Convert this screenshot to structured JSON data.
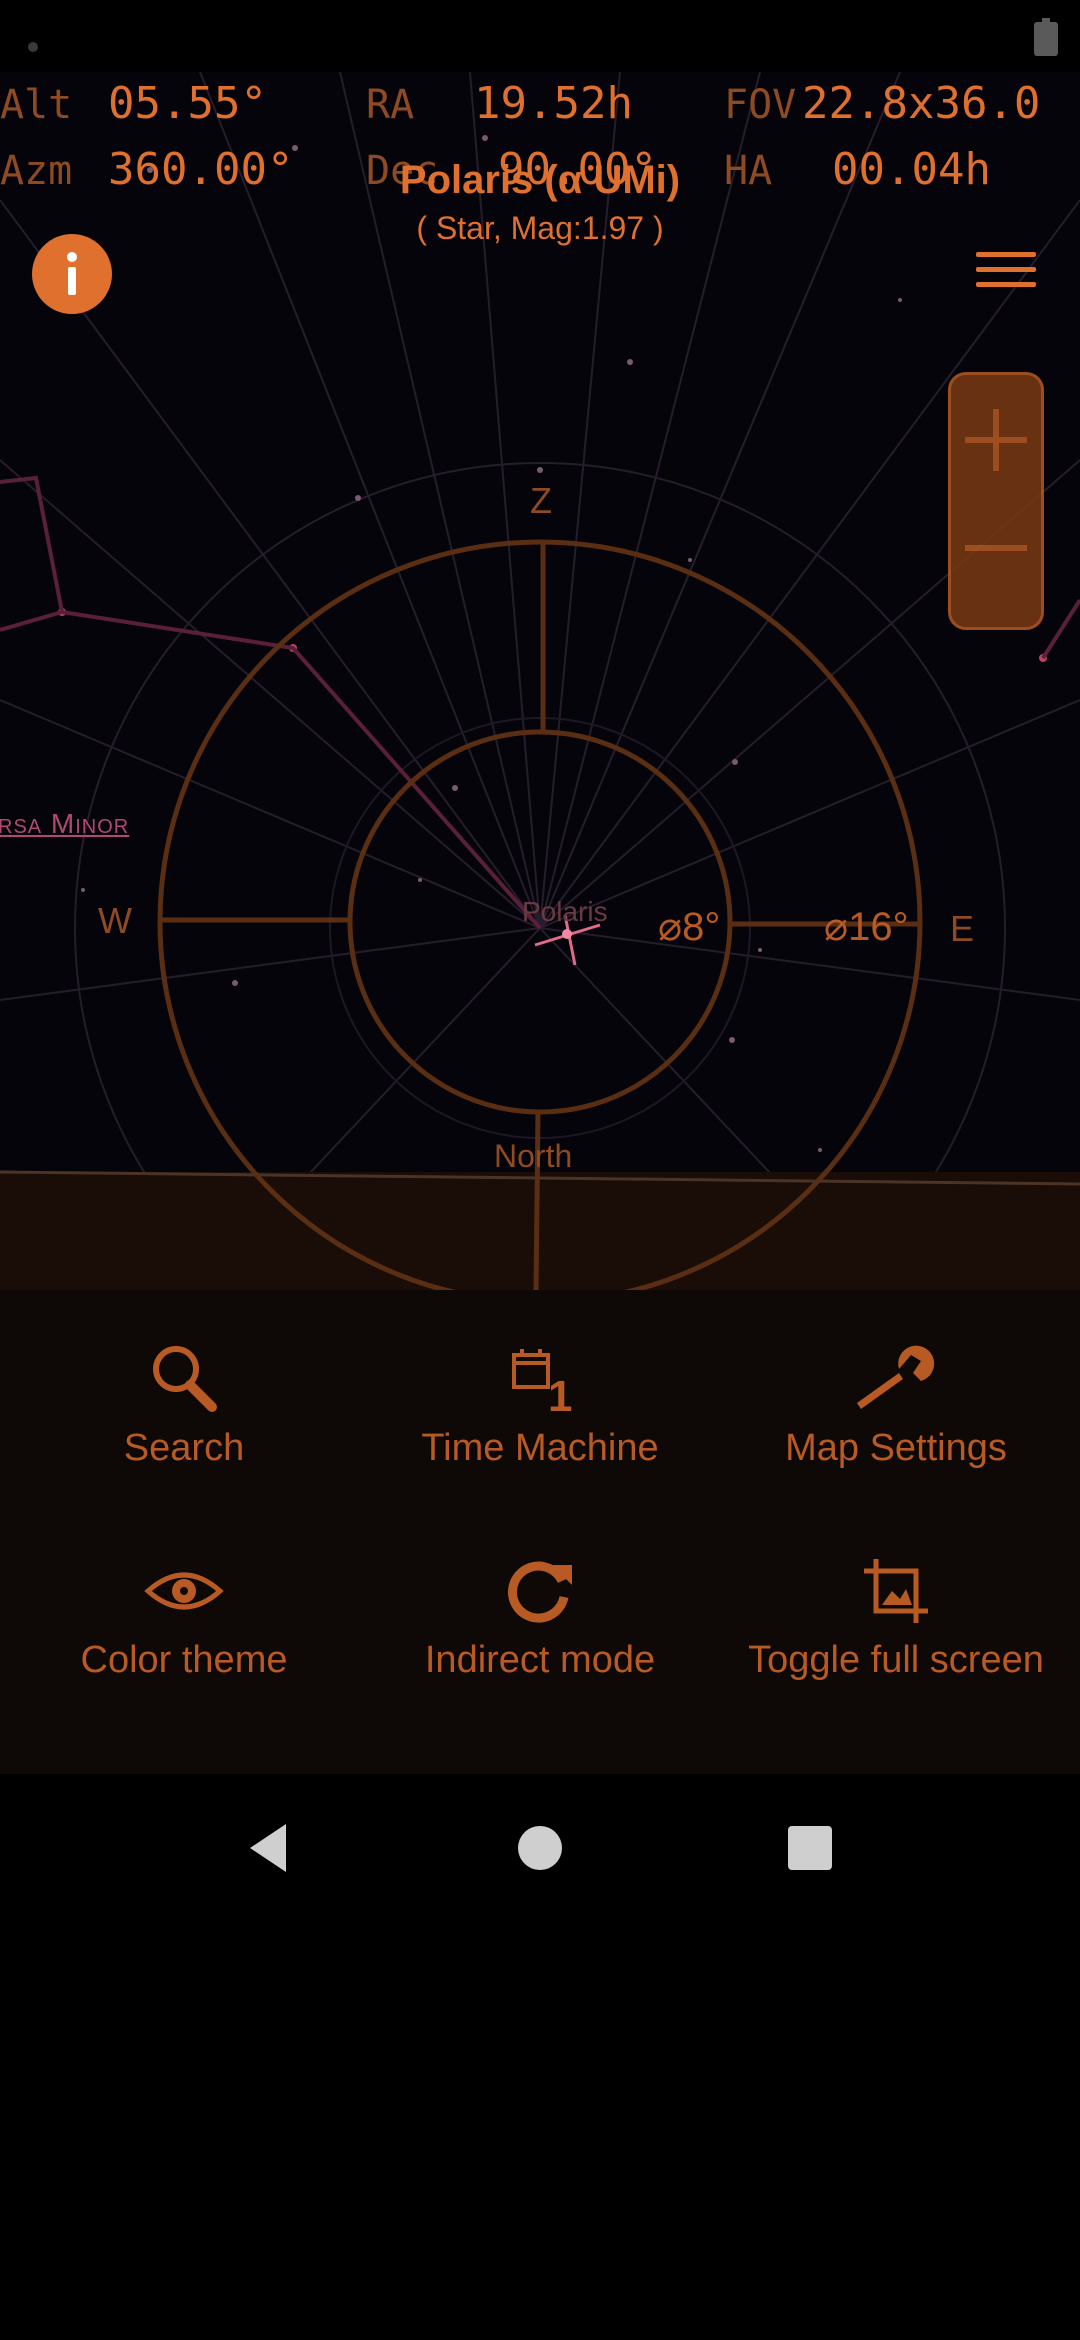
{
  "readouts": {
    "alt_label": "Alt",
    "alt_value": "05.55°",
    "ra_label": "RA",
    "ra_value": "19.52h",
    "fov_label": "FOV",
    "fov_value": "22.8x36.0",
    "azm_label": "Azm",
    "azm_value": "360.00°",
    "dec_label": "Dec",
    "dec_value": "90.00°",
    "ha_label": "HA",
    "ha_value": "00.04h"
  },
  "object": {
    "title": "Polaris (α UMi)",
    "subtitle": "( Star, Mag:1.97 )"
  },
  "sky": {
    "zenith_label": "Z",
    "west_label": "W",
    "east_label": "E",
    "north_label": "North",
    "constellation_label": "rsa Minor",
    "star_label": "Polaris",
    "inner_fov_label": "⌀8°",
    "outer_fov_label": "⌀16°"
  },
  "actions": [
    {
      "label": "Search",
      "icon": "search-icon"
    },
    {
      "label": "Time Machine",
      "icon": "calendar-icon",
      "badge": "1"
    },
    {
      "label": "Map Settings",
      "icon": "wrench-icon"
    },
    {
      "label": "Color theme",
      "icon": "eye-icon"
    },
    {
      "label": "Indirect mode",
      "icon": "refresh-icon"
    },
    {
      "label": "Toggle full screen",
      "icon": "crop-icon"
    }
  ],
  "colors": {
    "accent": "#e0702e",
    "dim_accent": "#b85a24",
    "sky_background": "#05040a",
    "panel_background": "#0e0807"
  }
}
